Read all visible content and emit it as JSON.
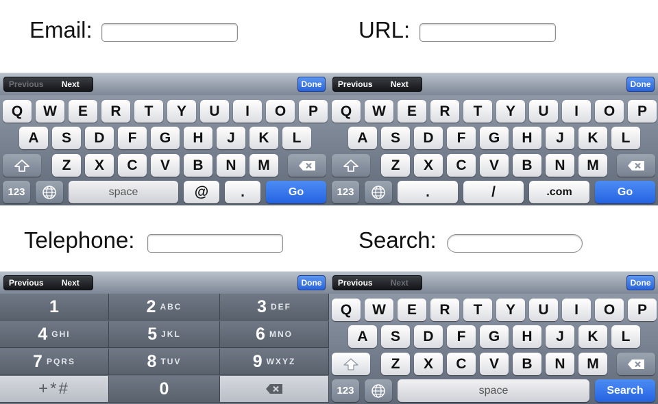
{
  "email": {
    "label": "Email:",
    "toolbar": {
      "previous": "Previous",
      "next": "Next",
      "done": "Done"
    },
    "rows": [
      [
        "Q",
        "W",
        "E",
        "R",
        "T",
        "Y",
        "U",
        "I",
        "O",
        "P"
      ],
      [
        "A",
        "S",
        "D",
        "F",
        "G",
        "H",
        "J",
        "K",
        "L"
      ],
      [
        "Z",
        "X",
        "C",
        "V",
        "B",
        "N",
        "M"
      ]
    ],
    "bottom": {
      "numbers": "123",
      "space": "space",
      "at": "@",
      "dot": ".",
      "action": "Go"
    }
  },
  "url": {
    "label": "URL:",
    "toolbar": {
      "previous": "Previous",
      "next": "Next",
      "done": "Done"
    },
    "rows": [
      [
        "Q",
        "W",
        "E",
        "R",
        "T",
        "Y",
        "U",
        "I",
        "O",
        "P"
      ],
      [
        "A",
        "S",
        "D",
        "F",
        "G",
        "H",
        "J",
        "K",
        "L"
      ],
      [
        "Z",
        "X",
        "C",
        "V",
        "B",
        "N",
        "M"
      ]
    ],
    "bottom": {
      "numbers": "123",
      "dot": ".",
      "slash": "/",
      "com": ".com",
      "action": "Go"
    }
  },
  "telephone": {
    "label": "Telephone:",
    "toolbar": {
      "previous": "Previous",
      "next": "Next",
      "done": "Done"
    },
    "keys": [
      {
        "num": "1",
        "letters": ""
      },
      {
        "num": "2",
        "letters": "ABC"
      },
      {
        "num": "3",
        "letters": "DEF"
      },
      {
        "num": "4",
        "letters": "GHI"
      },
      {
        "num": "5",
        "letters": "JKL"
      },
      {
        "num": "6",
        "letters": "MNO"
      },
      {
        "num": "7",
        "letters": "PQRS"
      },
      {
        "num": "8",
        "letters": "TUV"
      },
      {
        "num": "9",
        "letters": "WXYZ"
      }
    ],
    "symbols": "+*#",
    "zero": "0"
  },
  "search": {
    "label": "Search:",
    "toolbar": {
      "previous": "Previous",
      "next": "Next",
      "done": "Done"
    },
    "rows": [
      [
        "Q",
        "W",
        "E",
        "R",
        "T",
        "Y",
        "U",
        "I",
        "O",
        "P"
      ],
      [
        "A",
        "S",
        "D",
        "F",
        "G",
        "H",
        "J",
        "K",
        "L"
      ],
      [
        "Z",
        "X",
        "C",
        "V",
        "B",
        "N",
        "M"
      ]
    ],
    "bottom": {
      "numbers": "123",
      "space": "space",
      "action": "Search"
    }
  },
  "colors": {
    "accent_blue": "#2a63d9",
    "keyboard_bg": "#7c8695"
  }
}
